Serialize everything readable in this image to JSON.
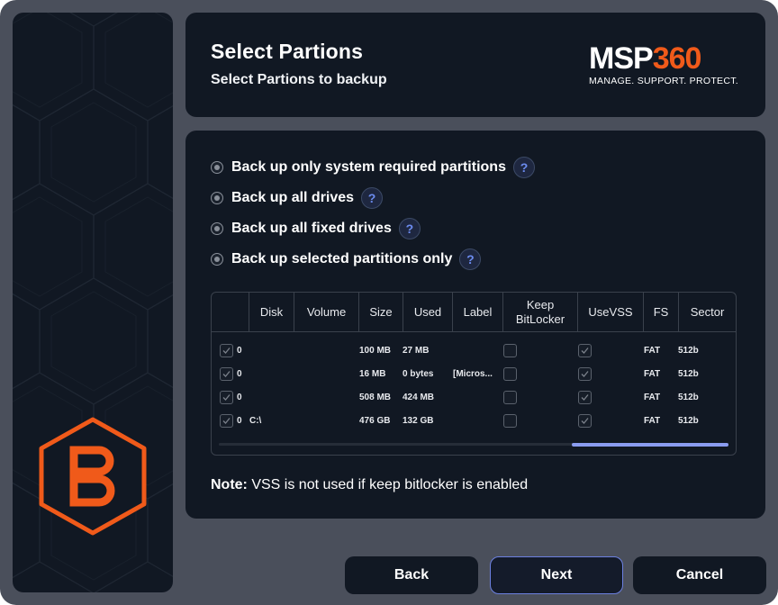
{
  "header": {
    "title": "Select Partions",
    "subtitle": "Select Partions to backup",
    "brand_word_white": "MSP",
    "brand_word_orange": "360",
    "brand_tagline": "MANAGE. SUPPORT. PROTECT."
  },
  "options": [
    {
      "label": "Back up only system required partitions",
      "help": "?"
    },
    {
      "label": "Back up all drives",
      "help": "?"
    },
    {
      "label": "Back up all fixed drives",
      "help": "?"
    },
    {
      "label": "Back up selected partitions only",
      "help": "?"
    }
  ],
  "table": {
    "headers": {
      "disk": "Disk",
      "volume": "Volume",
      "size": "Size",
      "used": "Used",
      "label": "Label",
      "keep_line1": "Keep",
      "keep_line2": "BitLocker",
      "usevss": "UseVSS",
      "fs": "FS",
      "sector": "Sector"
    },
    "rows": [
      {
        "disk": "0",
        "volume": "",
        "size": "100 MB",
        "used": "27 MB",
        "label": "",
        "fs": "FAT",
        "sector": "512b"
      },
      {
        "disk": "0",
        "volume": "",
        "size": "16 MB",
        "used": "0 bytes",
        "label": "[Micros...",
        "fs": "FAT",
        "sector": "512b"
      },
      {
        "disk": "0",
        "volume": "",
        "size": "508 MB",
        "used": "424 MB",
        "label": "",
        "fs": "FAT",
        "sector": "512b"
      },
      {
        "disk": "0",
        "volume": "C:\\",
        "size": "476 GB",
        "used": "132 GB",
        "label": "",
        "fs": "FAT",
        "sector": "512b"
      }
    ]
  },
  "note": {
    "prefix": "Note:",
    "text": " VSS is not used if keep bitlocker is enabled"
  },
  "buttons": {
    "back": "Back",
    "next": "Next",
    "cancel": "Cancel"
  },
  "colors": {
    "accent_orange": "#f05a1a",
    "panel": "#111823",
    "frame": "#4a4f5b",
    "primary_border": "#6c80e0"
  }
}
